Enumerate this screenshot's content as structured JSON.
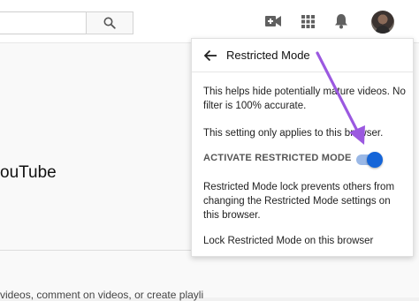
{
  "header": {
    "search_icon": "search-icon",
    "icons": [
      "video-camera-add-icon",
      "apps-grid-icon",
      "notification-bell-icon"
    ],
    "avatar": "user-avatar"
  },
  "background": {
    "heading_fragment": "ouTube",
    "text_fragment": "videos, comment on videos, or create playli"
  },
  "restricted_mode": {
    "title": "Restricted Mode",
    "description": "This helps hide potentially mature videos. No filter is 100% accurate.",
    "browser_note": "This setting only applies to this browser.",
    "activate_label": "ACTIVATE RESTRICTED MODE",
    "activated": true,
    "lock_description": "Restricted Mode lock prevents others from changing the Restricted Mode settings on this browser.",
    "lock_link": "Lock Restricted Mode on this browser"
  },
  "colors": {
    "toggle_on": "#1565d8",
    "toggle_track": "#9ab8e6",
    "annotation_arrow": "#9b59e0"
  }
}
